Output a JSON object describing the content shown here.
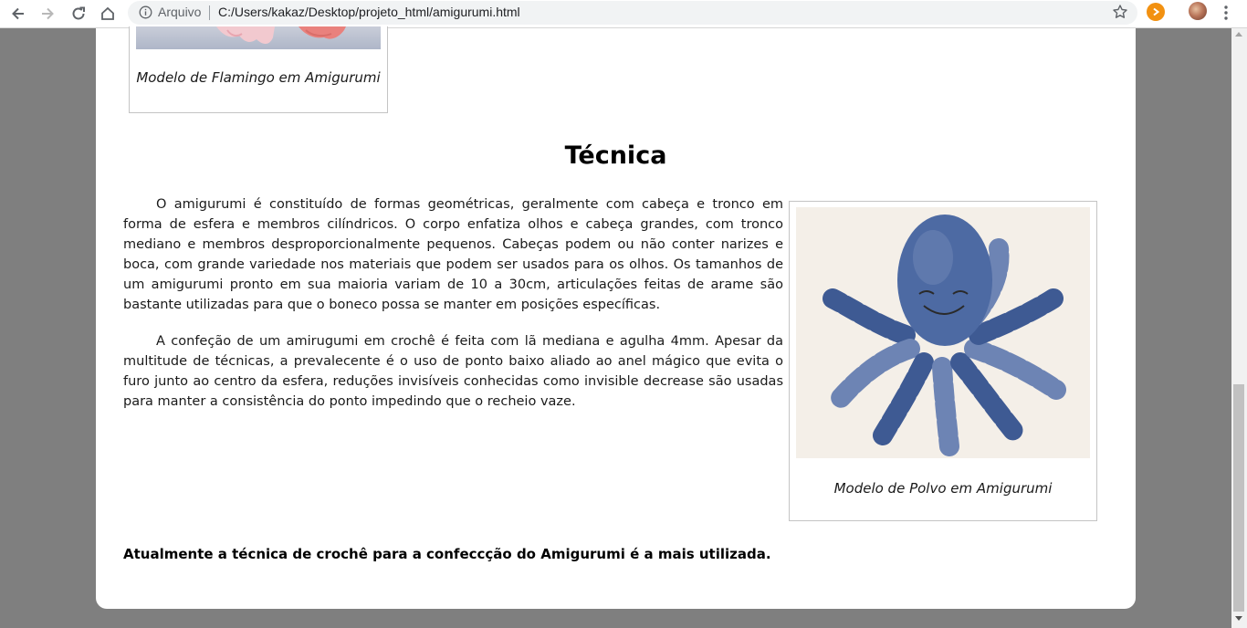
{
  "browser": {
    "scheme_label": "Arquivo",
    "url": "C:/Users/kakaz/Desktop/projeto_html/amigurumi.html",
    "icons": [
      "back-icon",
      "forward-icon",
      "reload-icon",
      "home-icon",
      "info-icon",
      "bookmark-star-icon",
      "extension-icon",
      "profile-avatar",
      "menu-icon"
    ]
  },
  "page": {
    "flamingo_caption": "Modelo de Flamingo em Amigurumi",
    "section_title": "Técnica",
    "paragraph_1": "O amigurumi é constituído de formas geométricas, geralmente com cabeça e tronco em forma de esfera e membros cilíndricos. O corpo enfatiza olhos e cabeça grandes, com tronco mediano e membros desproporcionalmente pequenos. Cabeças podem ou não conter narizes e boca, com grande variedade nos materiais que podem ser usados para os olhos. Os tamanhos de um amigurumi pronto em sua maioria variam de 10 a 30cm, articulações feitas de arame são bastante utilizadas para que o boneco possa se manter em posições específicas.",
    "paragraph_2": "A confeção de um amirugumi em crochê é feita com lã mediana e agulha 4mm. Apesar da multitude de técnicas, a prevalecente é o uso de ponto baixo aliado ao anel mágico que evita o furo junto ao centro da esfera, reduções invisíveis conhecidas como invisible decrease são usadas para manter a consistência do ponto impedindo que o recheio vaze.",
    "octopus_caption": "Modelo de Polvo em Amigurumi",
    "conclusion": "Atualmente a técnica de crochê para a confeccção do Amigurumi é a mais utilizada."
  },
  "colors": {
    "page_background": "#7f7f7f",
    "card_background": "#ffffff",
    "octopus_blue": "#3f5b93",
    "extension_orange": "#f29111"
  }
}
